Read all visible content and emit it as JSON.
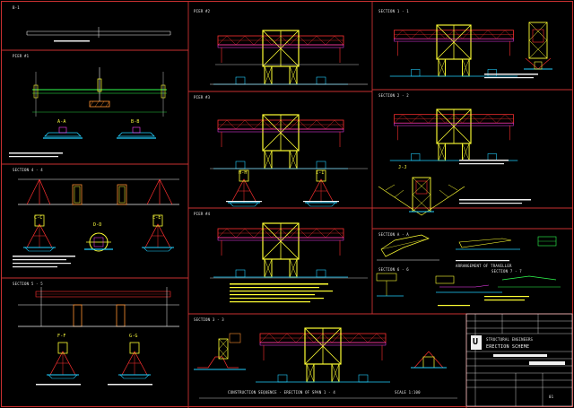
{
  "sheet": {
    "background": "#000000",
    "frame_color": "#c83030",
    "colors": {
      "yellow": "#ffff33",
      "cyan": "#22d0ff",
      "red": "#ff3030",
      "magenta": "#ff40ff",
      "green": "#30ff50",
      "white": "#f0f0f0",
      "orange": "#ff9030",
      "blue": "#3060ff"
    }
  },
  "views": {
    "v1": "B-1",
    "v2": "PIER #1",
    "v3": "SECTION 4 - 4",
    "v4": "SECTION 5 - 5",
    "v5": "PIER #2",
    "v6": "PIER #3",
    "v7": "PIER #4",
    "v8": "SECTION 1 - 1",
    "v9": "SECTION 2 - 2",
    "v10": "SECTION 3 - 3",
    "v11": "SECTION A - A",
    "v12": "SECTION 6 - 6",
    "v13": "SECTION 7 - 7"
  },
  "marks": {
    "a": "A-A",
    "b": "B-B",
    "c": "C-C",
    "d": "D-D",
    "e": "E-E",
    "f": "F-F",
    "g": "G-G",
    "h": "H-H",
    "i": "I-I",
    "j": "J-J"
  },
  "bottom_note": "CONSTRUCTION SEQUENCE - ERECTION OF SPAN 1 - 4",
  "bottom_note_right": "SCALE 1:100",
  "detail_caption": "ARRANGEMENT OF TRAVELLER",
  "title_block": {
    "logo": "U",
    "company": "STRUCTURAL ENGINEERS",
    "drawing_title": "ERECTION SCHEME",
    "sheet_no": "01"
  }
}
